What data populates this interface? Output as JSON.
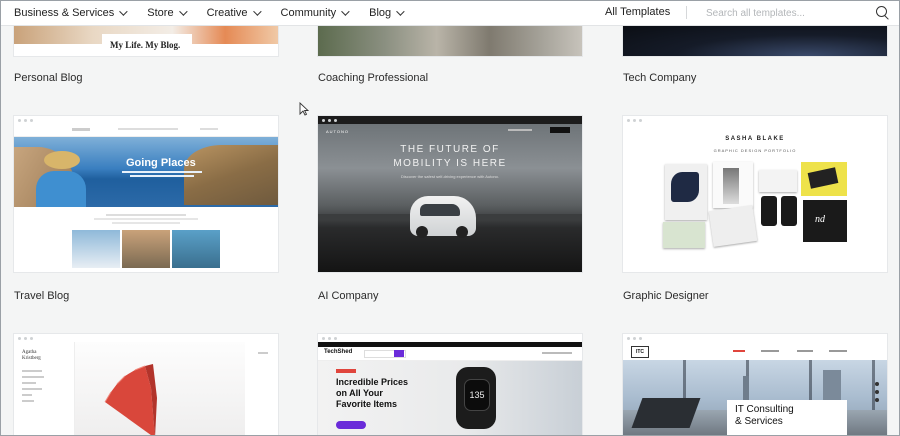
{
  "nav": {
    "menus": [
      {
        "label": "Business & Services"
      },
      {
        "label": "Store"
      },
      {
        "label": "Creative"
      },
      {
        "label": "Community"
      },
      {
        "label": "Blog"
      }
    ],
    "all_templates": "All Templates",
    "search_placeholder": "Search all templates..."
  },
  "cards": {
    "row1": [
      "Personal Blog",
      "Coaching Professional",
      "Tech Company"
    ],
    "row2": [
      "Travel Blog",
      "AI Company",
      "Graphic Designer"
    ]
  },
  "thumbs": {
    "personal_blog": {
      "caption": "My Life. My Blog."
    },
    "travel_blog": {
      "hero": "Going Places"
    },
    "ai_company": {
      "brand": "AUTONO",
      "headline_1": "THE FUTURE OF",
      "headline_2": "MOBILITY IS HERE",
      "sub": "Discover the safest self-driving experience with Autono."
    },
    "graphic_designer": {
      "name": "SASHA BLAKE",
      "sub": "GRAPHIC DESIGN PORTFOLIO"
    },
    "blog_agatha": {
      "author_1": "Agatha",
      "author_2": "Kristberg"
    },
    "techshed": {
      "brand": "TechShed",
      "line_1": "Incredible Prices",
      "line_2": "on All Your",
      "line_3": "Favorite Items",
      "watch": "135"
    },
    "it_consulting": {
      "logo": "ITC",
      "line_1": "IT Consulting",
      "line_2": "& Services"
    }
  },
  "colors": {
    "accent_purple": "#6a2bd9",
    "red_accent": "#e0453c",
    "page_bg": "#f4f5f5"
  }
}
